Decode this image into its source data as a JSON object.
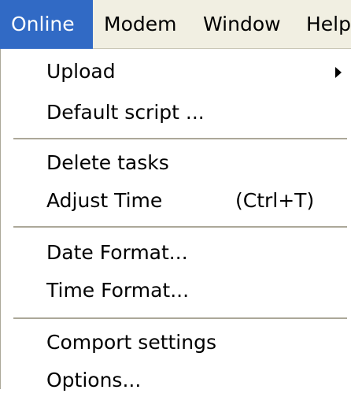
{
  "menubar": {
    "items": [
      {
        "label": "Online",
        "active": true
      },
      {
        "label": "Modem"
      },
      {
        "label": "Window"
      },
      {
        "label": "Help"
      }
    ]
  },
  "colors": {
    "highlight": "#316ac5",
    "menubar_bg": "#f1efe2",
    "separator": "#aca899"
  },
  "dropdown": {
    "items": [
      {
        "label": "Upload",
        "submenu": true,
        "icon": "submenu-arrow-icon"
      },
      {
        "label": "Default script ..."
      },
      {
        "label": "Delete tasks"
      },
      {
        "label": "Adjust Time",
        "shortcut": "(Ctrl+T)"
      },
      {
        "label": "Date Format..."
      },
      {
        "label": "Time Format..."
      },
      {
        "label": "Comport settings"
      },
      {
        "label": "Options..."
      }
    ]
  }
}
